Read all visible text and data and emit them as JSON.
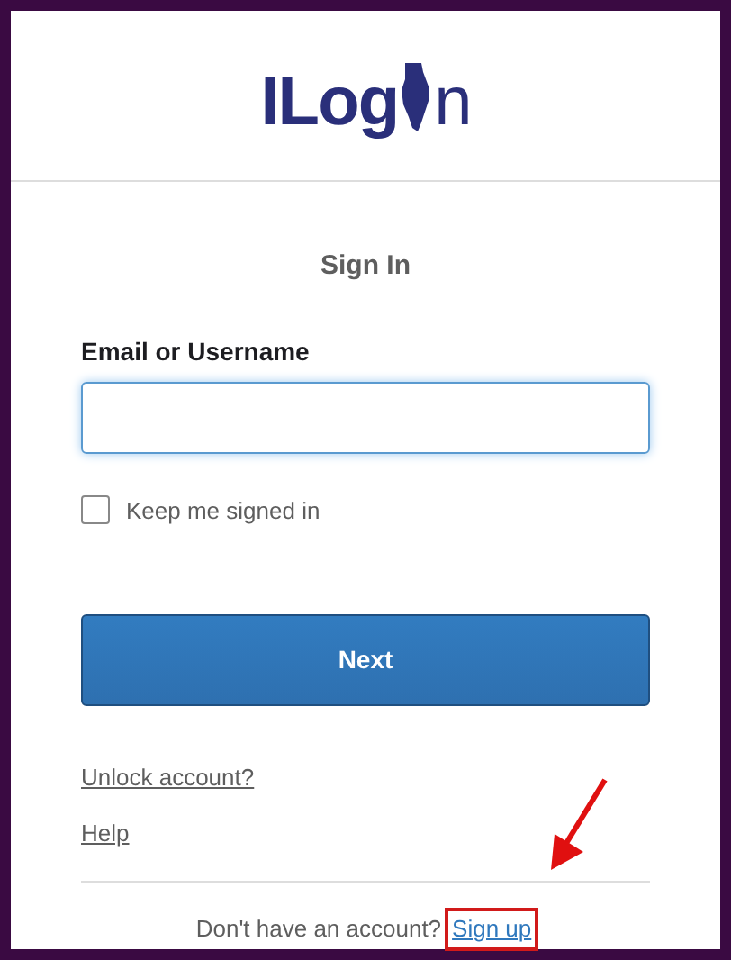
{
  "logo": {
    "lead": "ILog",
    "tail": "n"
  },
  "title": "Sign In",
  "email": {
    "label": "Email or Username"
  },
  "remember": {
    "label": "Keep me signed in",
    "checked": false
  },
  "next_button": "Next",
  "links": [
    "Unlock account?",
    "Help"
  ],
  "signup": {
    "prompt": "Don't have an account?",
    "link": "Sign up",
    "highlighted": true
  }
}
